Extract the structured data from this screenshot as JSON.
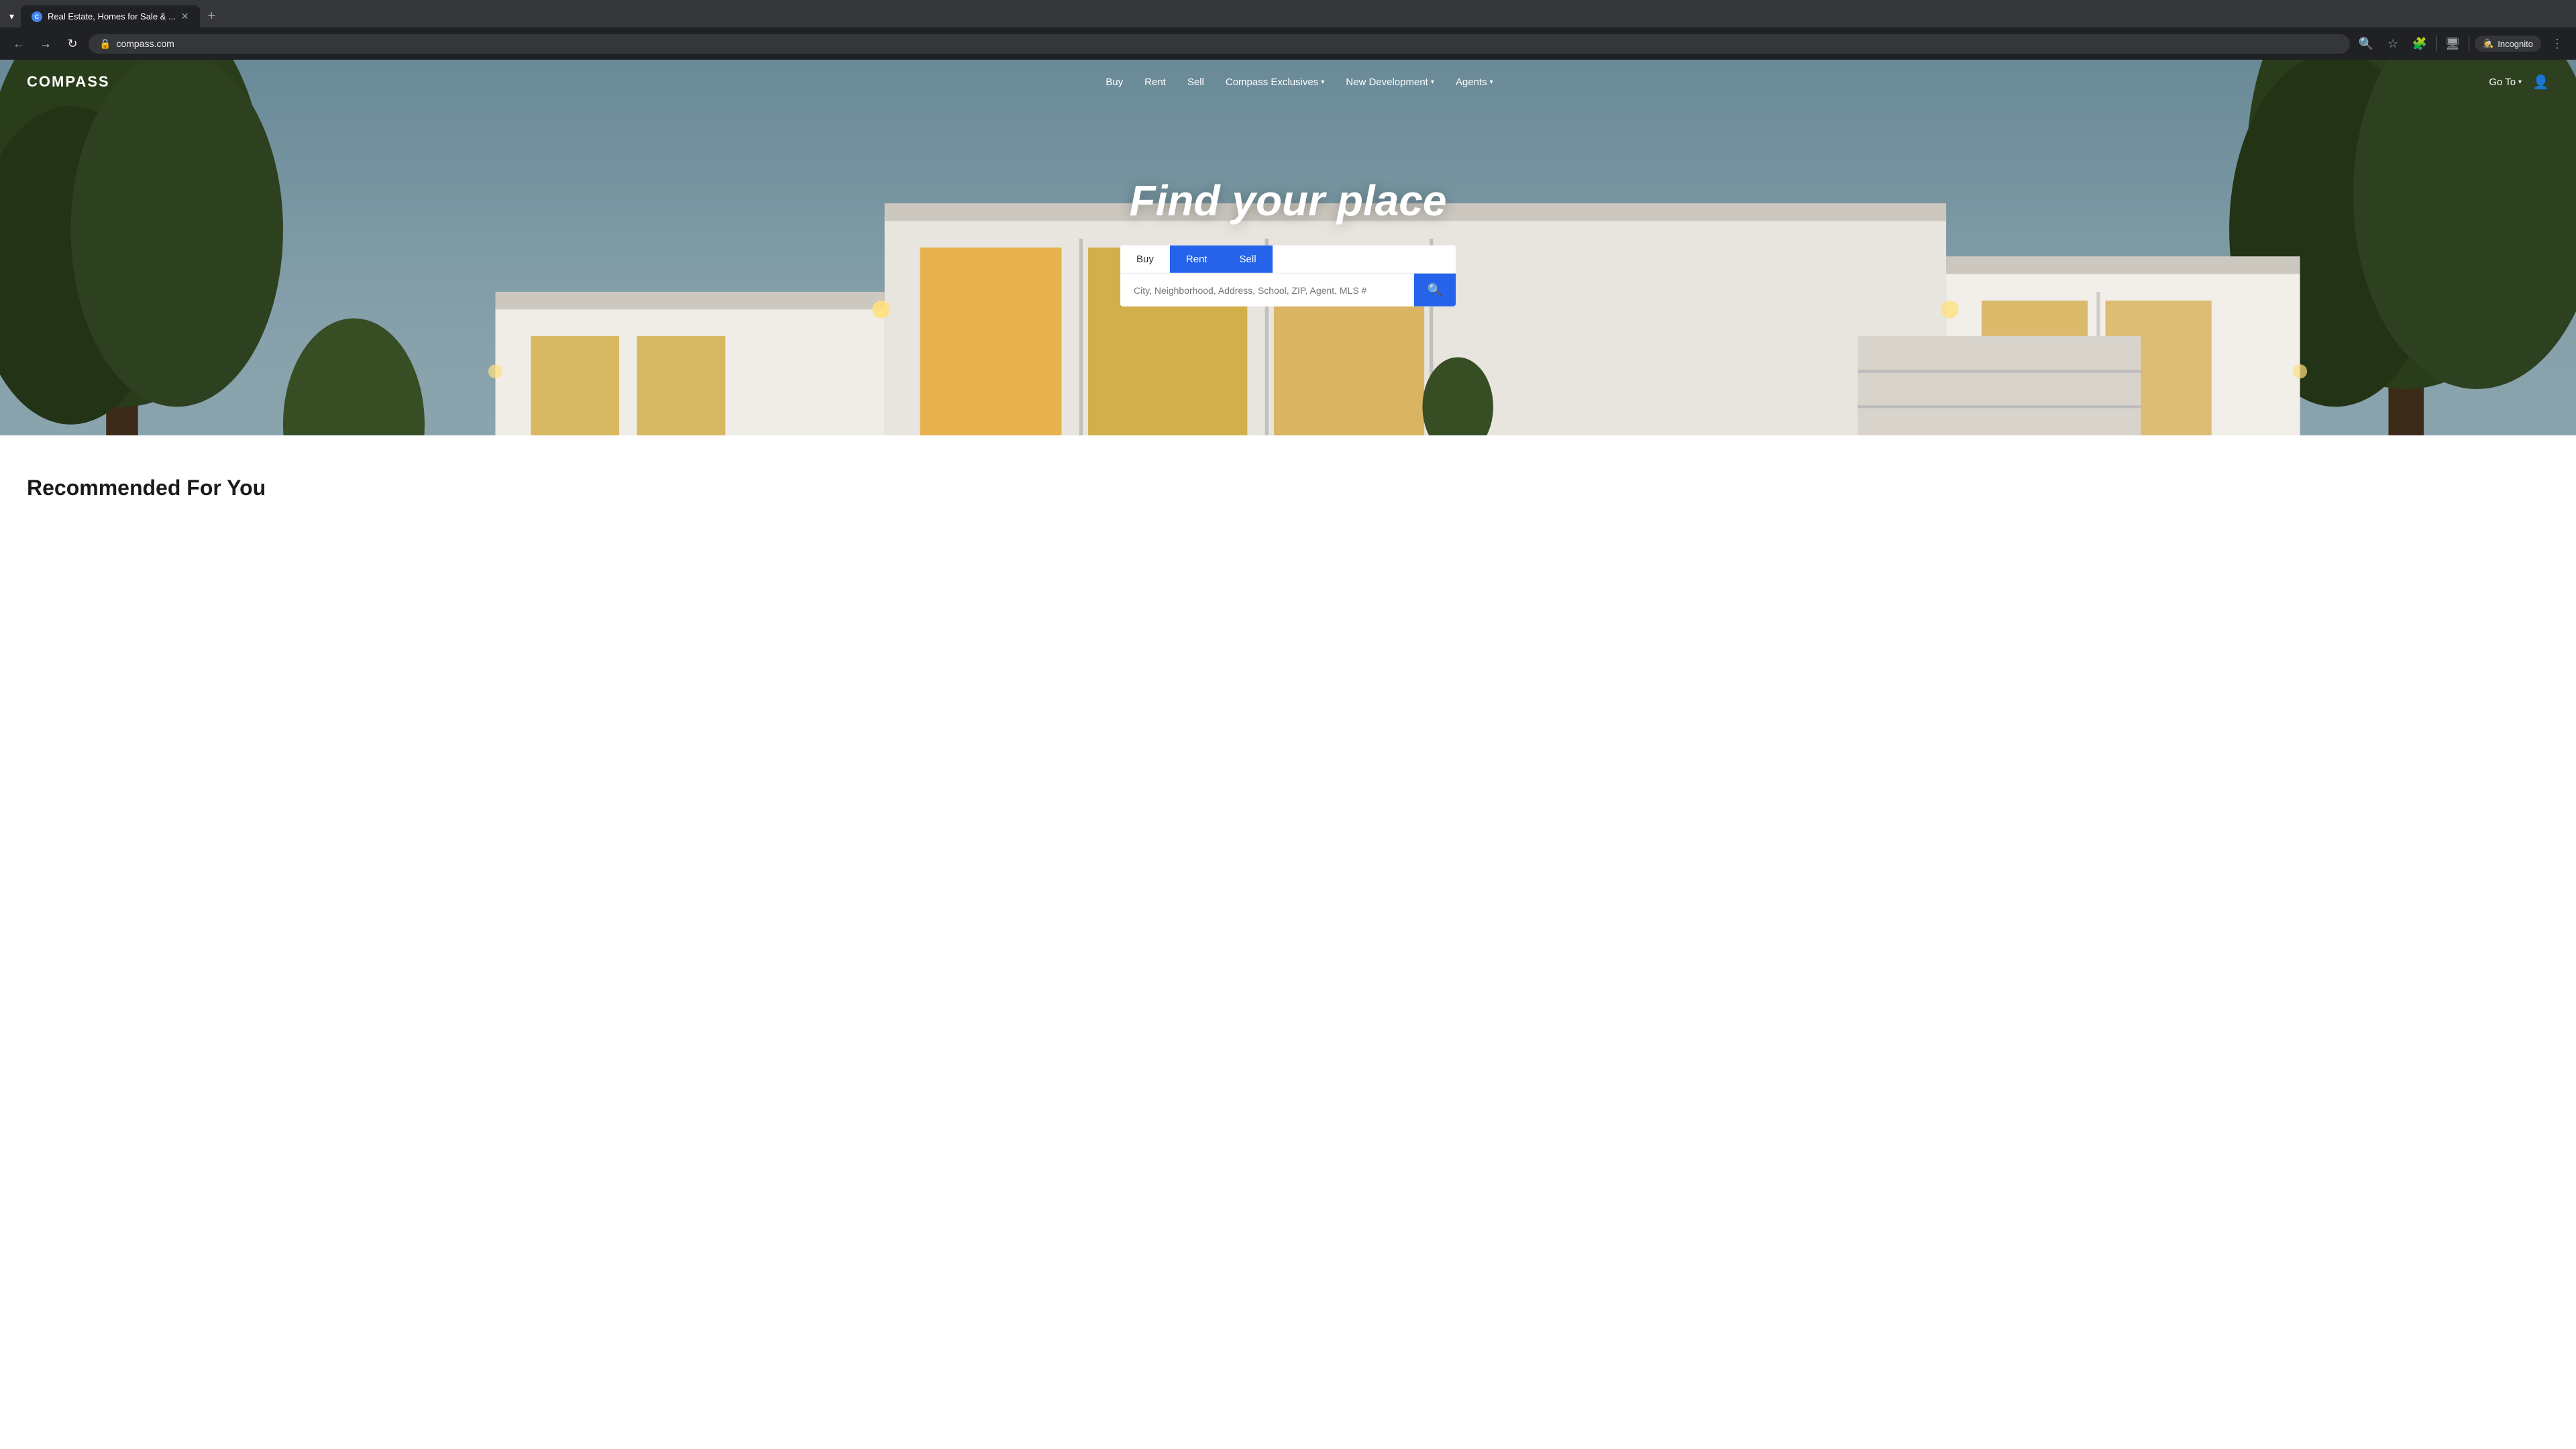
{
  "browser": {
    "tab_label": "Real Estate, Homes for Sale & ...",
    "tab_favicon": "C",
    "url": "compass.com",
    "new_tab_label": "+",
    "nav_back_label": "←",
    "nav_forward_label": "→",
    "nav_refresh_label": "↺",
    "incognito_label": "Incognito",
    "menu_label": "⋮"
  },
  "nav": {
    "logo": "COMPASS",
    "links": [
      {
        "label": "Buy",
        "has_dropdown": false
      },
      {
        "label": "Rent",
        "has_dropdown": false
      },
      {
        "label": "Sell",
        "has_dropdown": false
      },
      {
        "label": "Compass Exclusives",
        "has_dropdown": true
      },
      {
        "label": "New Development",
        "has_dropdown": true
      },
      {
        "label": "Agents",
        "has_dropdown": true
      }
    ],
    "goto_label": "Go To",
    "goto_has_dropdown": true
  },
  "hero": {
    "title": "Find your place",
    "search_tabs": [
      {
        "label": "Buy",
        "active": false
      },
      {
        "label": "Rent",
        "active": true
      },
      {
        "label": "Sell",
        "active": true
      }
    ],
    "search_placeholder": "City, Neighborhood, Address, School, ZIP, Agent, MLS #"
  },
  "below_hero": {
    "recommended_title": "Recommended For You"
  },
  "colors": {
    "accent_blue": "#2563eb",
    "nav_text": "#ffffff",
    "hero_bg_top": "#7a9fb5",
    "search_tab_active": "#2563eb"
  }
}
